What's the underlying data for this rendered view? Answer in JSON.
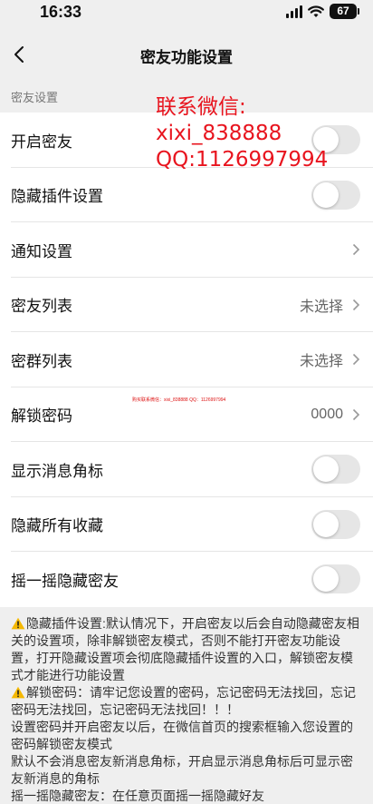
{
  "status_bar": {
    "time": "16:33",
    "battery": "67"
  },
  "nav": {
    "title": "密友功能设置"
  },
  "section": {
    "title": "密友设置"
  },
  "rows": [
    {
      "label": "开启密友",
      "type": "toggle",
      "on": false
    },
    {
      "label": "隐藏插件设置",
      "type": "toggle",
      "on": false
    },
    {
      "label": "通知设置",
      "type": "link",
      "value": ""
    },
    {
      "label": "密友列表",
      "type": "link",
      "value": "未选择"
    },
    {
      "label": "密群列表",
      "type": "link",
      "value": "未选择"
    },
    {
      "label": "解锁密码",
      "type": "link",
      "value": "0000"
    },
    {
      "label": "显示消息角标",
      "type": "toggle",
      "on": false
    },
    {
      "label": "隐藏所有收藏",
      "type": "toggle",
      "on": false
    },
    {
      "label": "摇一摇隐藏密友",
      "type": "toggle",
      "on": false
    }
  ],
  "watermark": {
    "line1": "联系微信:",
    "line2": "xixi_838888",
    "line3": "QQ:1126997994",
    "tiny": "购买联系微信：xixi_838888  QQ：1126997994"
  },
  "notes": [
    "隐藏插件设置:默认情况下，开启密友以后会自动隐藏密友相关的设置项，除非解锁密友模式，否则不能打开密友功能设置，打开隐藏设置项会彻底隐藏插件设置的入口，解锁密友模式才能进行功能设置",
    "解锁密码：请牢记您设置的密码，忘记密码无法找回，忘记密码无法找回，忘记密码无法找回！！！",
    "设置密码并开启密友以后，在微信首页的搜索框输入您设置的密码解锁密友模式",
    "默认不会消息密友新消息角标，开启显示消息角标后可显示密友新消息的角标",
    "摇一摇隐藏密友：在任意页面摇一摇隐藏好友"
  ],
  "colors": {
    "watermark": "#e8141e",
    "warning": "#f5b800",
    "toggle_off": "#e6e6e6"
  }
}
